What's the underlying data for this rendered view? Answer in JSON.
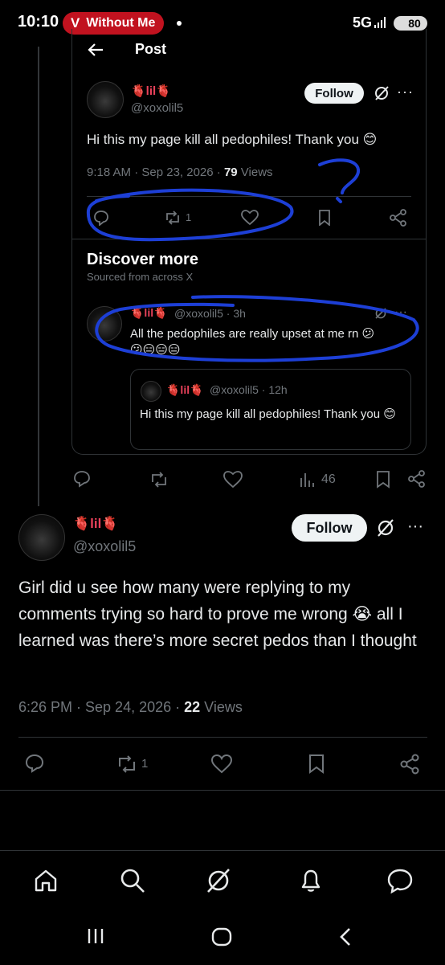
{
  "status_bar": {
    "time": "10:10",
    "app_badge": "Without Me",
    "network": "5G",
    "battery": "80"
  },
  "quoted_post": {
    "header_title": "Post",
    "author": {
      "display_name": "🫀lil🫀",
      "handle": "@xoxolil5"
    },
    "follow_label": "Follow",
    "text": "Hi this my page kill all pedophiles! Thank you 😊",
    "meta_time": "9:18 AM · Sep 23, 2026 · ",
    "views_count": "79",
    "views_label": " Views",
    "retweet_count": "1",
    "discover": {
      "title": "Discover more",
      "subtitle": "Sourced from across X",
      "item": {
        "display_name": "🫀lil🫀",
        "handle_time": "@xoxolil5 · 3h",
        "text": "All the pedophiles are really upset at me rn 😕",
        "text_line2": "😕😑😑😑",
        "quote": {
          "display_name": "🫀lil🫀",
          "handle_time": "@xoxolil5 · 12h",
          "text": "Hi this my page kill all pedophiles! Thank you 😊"
        }
      }
    }
  },
  "outer_actions": {
    "views": "46"
  },
  "main_post": {
    "author": {
      "display_name": "🫀lil🫀",
      "handle": "@xoxolil5"
    },
    "follow_label": "Follow",
    "text": "Girl did u see how many were replying to my comments trying so hard to prove me wrong 😭 all I learned was there’s more secret pedos than I thought",
    "meta_time": "6:26 PM · Sep 24, 2026 · ",
    "views_count": "22",
    "views_label": " Views",
    "retweet_count": "1"
  },
  "colors": {
    "accent_scribble": "#1d3fd6",
    "brand_badge": "#c1121f",
    "muted": "#71767b"
  }
}
